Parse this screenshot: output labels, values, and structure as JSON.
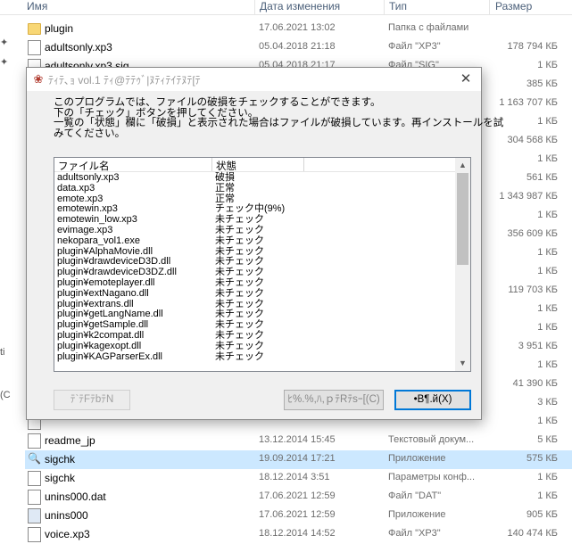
{
  "explorer": {
    "columns": {
      "name": "Имя",
      "date": "Дата изменения",
      "type": "Тип",
      "size": "Размер"
    },
    "left_edge": [
      "ti",
      "(C"
    ],
    "files": [
      {
        "name": "plugin",
        "date": "17.06.2021 13:02",
        "type": "Папка с файлами",
        "size": "",
        "icon": "folder-icon"
      },
      {
        "name": "adultsonly.xp3",
        "date": "05.04.2018 21:18",
        "type": "Файл \"XP3\"",
        "size": "178 794 КБ",
        "icon": "file-icon"
      },
      {
        "name": "adultsonly.xp3.sig",
        "date": "05.04.2018 21:17",
        "type": "Файл \"SIG\"",
        "size": "1 КБ",
        "icon": "file-icon"
      },
      {
        "name": "",
        "date": "",
        "type": "",
        "size": "385 КБ",
        "icon": "paw-icon"
      },
      {
        "name": "",
        "date": "",
        "type": "",
        "size": "1 163 707 КБ",
        "icon": "file-icon"
      },
      {
        "name": "",
        "date": "",
        "type": "",
        "size": "1 КБ",
        "icon": "file-icon"
      },
      {
        "name": "",
        "date": "",
        "type": "",
        "size": "304 568 КБ",
        "icon": "file-icon"
      },
      {
        "name": "",
        "date": "",
        "type": "",
        "size": "1 КБ",
        "icon": "file-icon"
      },
      {
        "name": "",
        "date": "",
        "type": "",
        "size": "561 КБ",
        "icon": "file-icon"
      },
      {
        "name": "",
        "date": "",
        "type": "",
        "size": "1 343 987 КБ",
        "icon": "file-icon"
      },
      {
        "name": "",
        "date": "",
        "type": "",
        "size": "1 КБ",
        "icon": "file-icon"
      },
      {
        "name": "",
        "date": "",
        "type": "",
        "size": "356 609 КБ",
        "icon": "file-icon"
      },
      {
        "name": "",
        "date": "",
        "type": "",
        "size": "1 КБ",
        "icon": "file-icon"
      },
      {
        "name": "",
        "date": "",
        "type": "",
        "size": "1 КБ",
        "icon": "file-icon"
      },
      {
        "name": "",
        "date": "",
        "type": "",
        "size": "119 703 КБ",
        "icon": "file-icon"
      },
      {
        "name": "",
        "date": "",
        "type": "",
        "size": "1 КБ",
        "icon": "file-icon"
      },
      {
        "name": "",
        "date": "",
        "type": "",
        "size": "1 КБ",
        "icon": "file-icon"
      },
      {
        "name": "",
        "date": "",
        "type": "",
        "size": "3 951 КБ",
        "icon": "paw-icon"
      },
      {
        "name": "",
        "date": "",
        "type": "",
        "size": "1 КБ",
        "icon": "file-icon"
      },
      {
        "name": "",
        "date": "",
        "type": "",
        "size": "41 390 КБ",
        "icon": "file-icon"
      },
      {
        "name": "",
        "date": "",
        "type": "",
        "size": "3 КБ",
        "icon": "file-icon"
      },
      {
        "name": "",
        "date": "",
        "type": "",
        "size": "1 КБ",
        "icon": "file-icon"
      },
      {
        "name": "readme_jp",
        "date": "13.12.2014 15:45",
        "type": "Текстовый докум...",
        "size": "5 КБ",
        "icon": "file-icon"
      },
      {
        "name": "sigchk",
        "date": "19.09.2014 17:21",
        "type": "Приложение",
        "size": "575 КБ",
        "icon": "magnifier-icon",
        "selected": true
      },
      {
        "name": "sigchk",
        "date": "18.12.2014 3:51",
        "type": "Параметры конф...",
        "size": "1 КБ",
        "icon": "config-file-icon"
      },
      {
        "name": "unins000.dat",
        "date": "17.06.2021 12:59",
        "type": "Файл \"DAT\"",
        "size": "1 КБ",
        "icon": "file-icon"
      },
      {
        "name": "unins000",
        "date": "17.06.2021 12:59",
        "type": "Приложение",
        "size": "905 КБ",
        "icon": "installer-icon"
      },
      {
        "name": "voice.xp3",
        "date": "18.12.2014 14:52",
        "type": "Файл \"XP3\"",
        "size": "140 474 КБ",
        "icon": "file-icon"
      }
    ]
  },
  "dialog": {
    "title": "ﾃｨﾃ､ｮ vol.1 ﾃｨ@ﾃﾃｩﾞ|ﾇﾃｨﾃｲﾃﾇﾃ[ﾃ",
    "message_lines": [
      "このプログラムでは、ファイルの破損をチェックすることができます。",
      "下の「チェック」ボタンを押してください。",
      "一覧の「状態」欄に「破損」と表示された場合はファイルが破損しています。再インストールを試",
      "みてください。"
    ],
    "list": {
      "col_file": "ファイル名",
      "col_status": "状態",
      "rows": [
        {
          "file": "adultsonly.xp3",
          "status": "破損"
        },
        {
          "file": "data.xp3",
          "status": "正常"
        },
        {
          "file": "emote.xp3",
          "status": "正常"
        },
        {
          "file": "emotewin.xp3",
          "status": "チェック中(9%)"
        },
        {
          "file": "emotewin_low.xp3",
          "status": "未チェック"
        },
        {
          "file": "evimage.xp3",
          "status": "未チェック"
        },
        {
          "file": "nekopara_vol1.exe",
          "status": "未チェック"
        },
        {
          "file": "plugin¥AlphaMovie.dll",
          "status": "未チェック"
        },
        {
          "file": "plugin¥drawdeviceD3D.dll",
          "status": "未チェック"
        },
        {
          "file": "plugin¥drawdeviceD3DZ.dll",
          "status": "未チェック"
        },
        {
          "file": "plugin¥emoteplayer.dll",
          "status": "未チェック"
        },
        {
          "file": "plugin¥extNagano.dll",
          "status": "未チェック"
        },
        {
          "file": "plugin¥extrans.dll",
          "status": "未チェック"
        },
        {
          "file": "plugin¥getLangName.dll",
          "status": "未チェック"
        },
        {
          "file": "plugin¥getSample.dll",
          "status": "未チェック"
        },
        {
          "file": "plugin¥k2compat.dll",
          "status": "未チェック"
        },
        {
          "file": "plugin¥kagexopt.dll",
          "status": "未チェック"
        },
        {
          "file": "plugin¥KAGParserEx.dll",
          "status": "未チェック"
        }
      ]
    },
    "buttons": {
      "check": "ﾃ`ﾃFﾃbﾃN",
      "abort": "ﾋ%.%,ﾊ,ｐﾃRﾃsｰ[(C)",
      "close": "•B¶.й(X)"
    }
  }
}
